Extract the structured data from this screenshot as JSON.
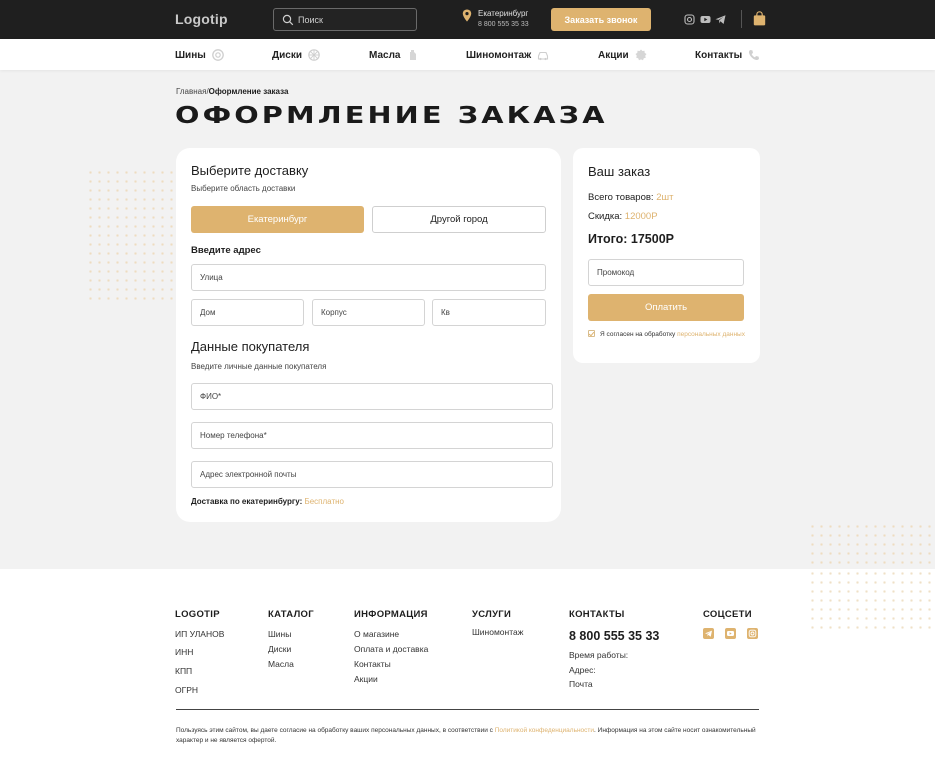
{
  "colors": {
    "accent": "#deb36f",
    "topbar": "#1f1f1f",
    "page_bg": "#f2f2f2"
  },
  "header": {
    "logo": "Logotip",
    "search_placeholder": "Поиск",
    "city": "Екатеринбург",
    "phone": "8 800 555 35 33",
    "callback_label": "Заказать звонок",
    "social_icons": [
      "instagram-icon",
      "youtube-icon",
      "telegram-icon"
    ],
    "cart_icon": "shopping-bag-icon"
  },
  "nav": [
    {
      "label": "Шины",
      "icon": "tire-icon"
    },
    {
      "label": "Диски",
      "icon": "wheel-icon"
    },
    {
      "label": "Масла",
      "icon": "oil-can-icon"
    },
    {
      "label": "Шиномонтаж",
      "icon": "car-service-icon"
    },
    {
      "label": "Акции",
      "icon": "discount-badge-icon"
    },
    {
      "label": "Контакты",
      "icon": "phone-icon"
    }
  ],
  "breadcrumb": {
    "home": "Главная/",
    "current": "Оформление заказа"
  },
  "page_title": "ОФОРМЛЕНИЕ ЗАКАЗА",
  "delivery": {
    "title": "Выберите доставку",
    "subtitle": "Выберите область доставки",
    "option_active": "Екатеринбург",
    "option_other": "Другой город",
    "address_label": "Введите адрес",
    "street_placeholder": "Улица",
    "house_placeholder": "Дом",
    "building_placeholder": "Корпус",
    "apartment_placeholder": "Кв",
    "buyer_title": "Данные покупателя",
    "buyer_subtitle": "Введите личные данные покупателя",
    "name_placeholder": "ФИО*",
    "phone_placeholder": "Номер телефона*",
    "email_placeholder": "Адрес электронной почты",
    "free_label": "Доставка по екатеринбургу:",
    "free_value": "Бесплатно"
  },
  "order": {
    "title": "Ваш заказ",
    "items_label": "Всего товаров:",
    "items_value": "2шт",
    "discount_label": "Скидка:",
    "discount_value": "12000Р",
    "total": "Итого: 17500Р",
    "promo_placeholder": "Промокод",
    "pay_label": "Оплатить",
    "agree_text": "Я согласен на обработку",
    "agree_link": "персональных данных",
    "agree_checked": true
  },
  "footer": {
    "brand": {
      "title": "LOGOTIP",
      "items": [
        "ИП УЛАНОВ",
        "ИНН",
        "КПП",
        "ОГРН"
      ]
    },
    "catalog": {
      "title": "КАТАЛОГ",
      "items": [
        "Шины",
        "Диски",
        "Масла"
      ]
    },
    "info": {
      "title": "ИНФОРМАЦИЯ",
      "items": [
        "О магазине",
        "Оплата и доставка",
        "Контакты",
        "Акции"
      ]
    },
    "services": {
      "title": "УСЛУГИ",
      "items": [
        "Шиномонтаж"
      ]
    },
    "contacts": {
      "title": "КОНТАКТЫ",
      "phone": "8 800 555 35 33",
      "items": [
        "Время работы:",
        "Адрес:",
        "Почта"
      ]
    },
    "social": {
      "title": "СОЦСЕТИ",
      "icons": [
        "telegram-icon",
        "youtube-icon",
        "instagram-icon"
      ]
    },
    "legal_before": "Пользуясь этим сайтом, вы даете согласие на обработку ваших персональных данных, в соответствии с ",
    "legal_link": "Политикой конфеденциальности",
    "legal_after": ". Информация на этом сайте носит ознакомительный характер и не является офертой."
  }
}
